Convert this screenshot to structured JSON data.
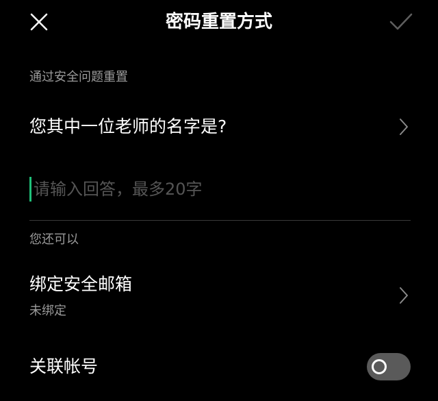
{
  "header": {
    "title": "密码重置方式",
    "close_icon": "close-icon",
    "confirm_icon": "check-icon"
  },
  "security_question_section": {
    "label": "通过安全问题重置",
    "question": "您其中一位老师的名字是?",
    "answer_placeholder": "请输入回答，最多20字",
    "answer_value": ""
  },
  "alternatives_section": {
    "label": "您还可以",
    "bind_email": {
      "title": "绑定安全邮箱",
      "status": "未绑定"
    },
    "linked_account": {
      "title": "关联帐号",
      "toggle_on": false
    }
  },
  "colors": {
    "background": "#000000",
    "text_primary": "#ffffff",
    "text_secondary": "#9a9a9a",
    "caret": "#20c17a",
    "toggle_off_track": "#5a5a5a"
  }
}
